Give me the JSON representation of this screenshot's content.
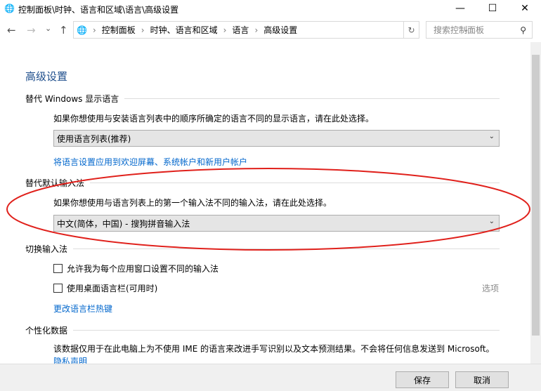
{
  "window": {
    "title": "控制面板\\时钟、语言和区域\\语言\\高级设置",
    "minimize": "—",
    "maximize": "☐",
    "close": "✕"
  },
  "nav": {
    "back": "←",
    "forward": "→",
    "recent": "⌄",
    "up": "↑"
  },
  "breadcrumb": [
    "控制面板",
    "时钟、语言和区域",
    "语言",
    "高级设置"
  ],
  "search": {
    "placeholder": "搜索控制面板"
  },
  "main": {
    "title": "高级设置",
    "display_lang": {
      "heading": "替代 Windows 显示语言",
      "desc": "如果你想使用与安装语言列表中的顺序所确定的语言不同的显示语言，请在此处选择。",
      "selected": "使用语言列表(推荐)",
      "link": "将语言设置应用到欢迎屏幕、系统帐户和新用户帐户"
    },
    "input_method": {
      "heading": "替代默认输入法",
      "desc": "如果你想使用与语言列表上的第一个输入法不同的输入法，请在此处选择。",
      "selected": "中文(简体，中国) - 搜狗拼音输入法"
    },
    "switch": {
      "heading": "切换输入法",
      "option1": "允许我为每个应用窗口设置不同的输入法",
      "option2": "使用桌面语言栏(可用时)",
      "options_link": "选项",
      "hotkey_link": "更改语言栏热键"
    },
    "personal": {
      "heading": "个性化数据",
      "desc": "该数据仅用于在此电脑上为不使用 IME 的语言来改进手写识别以及文本预测结果。不会将任何信息发送到 Microsoft。",
      "privacy_link": "隐私声明"
    }
  },
  "footer": {
    "save": "保存",
    "cancel": "取消"
  },
  "colors": {
    "annotation": "#e0201b",
    "link": "#0066cc"
  }
}
